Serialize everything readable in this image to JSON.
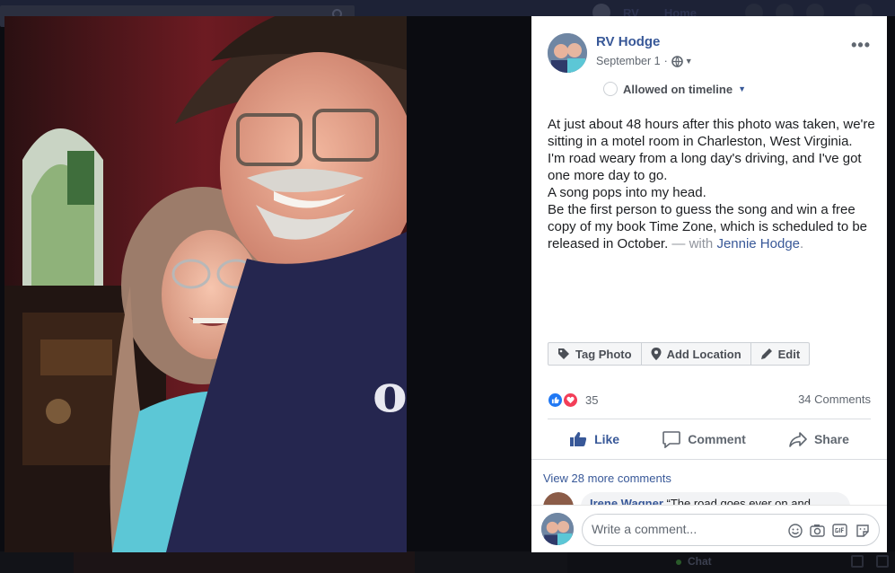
{
  "background": {
    "nav_name": "RV",
    "nav_home": "Home",
    "chat_label": "Chat"
  },
  "post": {
    "author": "RV Hodge",
    "date": "September 1",
    "separator": "·",
    "audience_label": "Allowed on timeline",
    "paragraphs": [
      "At just about 48 hours after this photo was taken, we're sitting in a motel room in Charleston, West Virginia.",
      "I'm road weary from a long day's driving, and I've got one more day to go.",
      "A song pops into my head.",
      "Be the first person to guess the song and win a free copy of my book Time Zone, which is scheduled to be released in October."
    ],
    "with_prefix": "— with",
    "tagged_person": "Jennie Hodge",
    "tagged_suffix": ".",
    "more_label": "•••"
  },
  "photo_tools": {
    "tag_photo": "Tag Photo",
    "add_location": "Add Location",
    "edit": "Edit"
  },
  "reactions": {
    "count": "35",
    "comments_count": "34 Comments"
  },
  "actions": {
    "like": "Like",
    "comment": "Comment",
    "share": "Share"
  },
  "comments": {
    "view_more": "View 28 more comments",
    "preview_author": "Irene Wagner",
    "preview_text": "“The road goes ever on and"
  },
  "composer": {
    "placeholder": "Write a comment..."
  },
  "colors": {
    "link_blue": "#385898",
    "like_blue": "#2078f4",
    "love_red": "#f33e58"
  }
}
